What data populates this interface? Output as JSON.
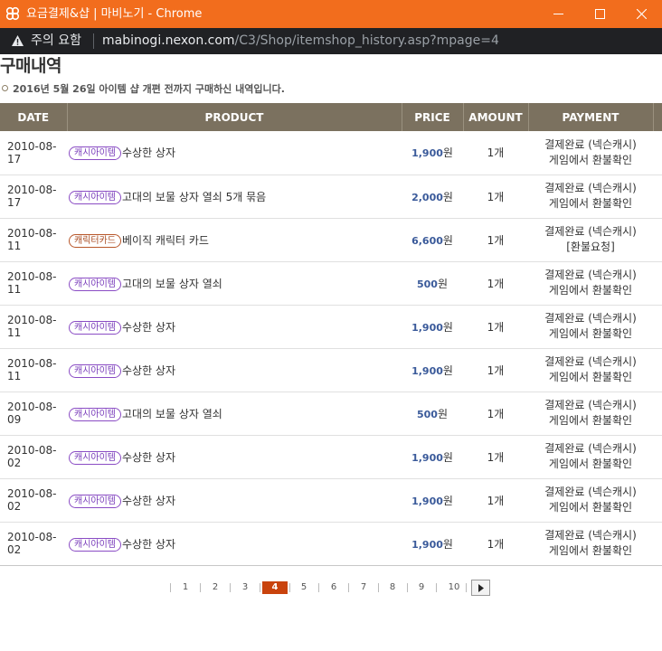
{
  "window": {
    "title": "요금결제&샵 | 마비노기 - Chrome"
  },
  "addressbar": {
    "warning_label": "주의 요함",
    "url_domain": "mabinogi.nexon.com",
    "url_path": "/C3/Shop/itemshop_history.asp?mpage=4"
  },
  "page": {
    "title": "구매내역",
    "subtitle": "2016년 5월 26일 아이템 샵 개편 전까지 구매하신 내역입니다."
  },
  "table": {
    "headers": [
      "DATE",
      "PRODUCT",
      "PRICE",
      "AMOUNT",
      "PAYMENT"
    ],
    "currency_suffix": "원",
    "rows": [
      {
        "date": "2010-08-17",
        "badge": "캐시아이템",
        "badge_type": "cash",
        "name": "수상한 상자",
        "price": "1,900",
        "amount": "1개",
        "pay1": "결제완료 (넥슨캐시)",
        "pay2": "게임에서 환불확인"
      },
      {
        "date": "2010-08-17",
        "badge": "캐시아이템",
        "badge_type": "cash",
        "name": "고대의 보물 상자 열쇠 5개 묶음",
        "price": "2,000",
        "amount": "1개",
        "pay1": "결제완료 (넥슨캐시)",
        "pay2": "게임에서 환불확인"
      },
      {
        "date": "2010-08-11",
        "badge": "캐릭터카드",
        "badge_type": "card",
        "name": "베이직 캐릭터 카드",
        "price": "6,600",
        "amount": "1개",
        "pay1": "결제완료 (넥슨캐시)",
        "pay2": "[환불요청]"
      },
      {
        "date": "2010-08-11",
        "badge": "캐시아이템",
        "badge_type": "cash",
        "name": "고대의 보물 상자 열쇠",
        "price": "500",
        "amount": "1개",
        "pay1": "결제완료 (넥슨캐시)",
        "pay2": "게임에서 환불확인"
      },
      {
        "date": "2010-08-11",
        "badge": "캐시아이템",
        "badge_type": "cash",
        "name": "수상한 상자",
        "price": "1,900",
        "amount": "1개",
        "pay1": "결제완료 (넥슨캐시)",
        "pay2": "게임에서 환불확인"
      },
      {
        "date": "2010-08-11",
        "badge": "캐시아이템",
        "badge_type": "cash",
        "name": "수상한 상자",
        "price": "1,900",
        "amount": "1개",
        "pay1": "결제완료 (넥슨캐시)",
        "pay2": "게임에서 환불확인"
      },
      {
        "date": "2010-08-09",
        "badge": "캐시아이템",
        "badge_type": "cash",
        "name": "고대의 보물 상자 열쇠",
        "price": "500",
        "amount": "1개",
        "pay1": "결제완료 (넥슨캐시)",
        "pay2": "게임에서 환불확인"
      },
      {
        "date": "2010-08-02",
        "badge": "캐시아이템",
        "badge_type": "cash",
        "name": "수상한 상자",
        "price": "1,900",
        "amount": "1개",
        "pay1": "결제완료 (넥슨캐시)",
        "pay2": "게임에서 환불확인"
      },
      {
        "date": "2010-08-02",
        "badge": "캐시아이템",
        "badge_type": "cash",
        "name": "수상한 상자",
        "price": "1,900",
        "amount": "1개",
        "pay1": "결제완료 (넥슨캐시)",
        "pay2": "게임에서 환불확인"
      },
      {
        "date": "2010-08-02",
        "badge": "캐시아이템",
        "badge_type": "cash",
        "name": "수상한 상자",
        "price": "1,900",
        "amount": "1개",
        "pay1": "결제완료 (넥슨캐시)",
        "pay2": "게임에서 환불확인"
      }
    ]
  },
  "pagination": {
    "pages": [
      "1",
      "2",
      "3",
      "4",
      "5",
      "6",
      "7",
      "8",
      "9",
      "10"
    ],
    "current": "4",
    "next_icon": "play-arrow-icon"
  },
  "colors": {
    "titlebar": "#f26d1d",
    "addressbar": "#202124",
    "table_header": "#7b715f",
    "cash_badge": "#8a4cc4",
    "card_badge": "#b8572a",
    "price": "#3a5a9a",
    "current_page": "#c9430d"
  }
}
